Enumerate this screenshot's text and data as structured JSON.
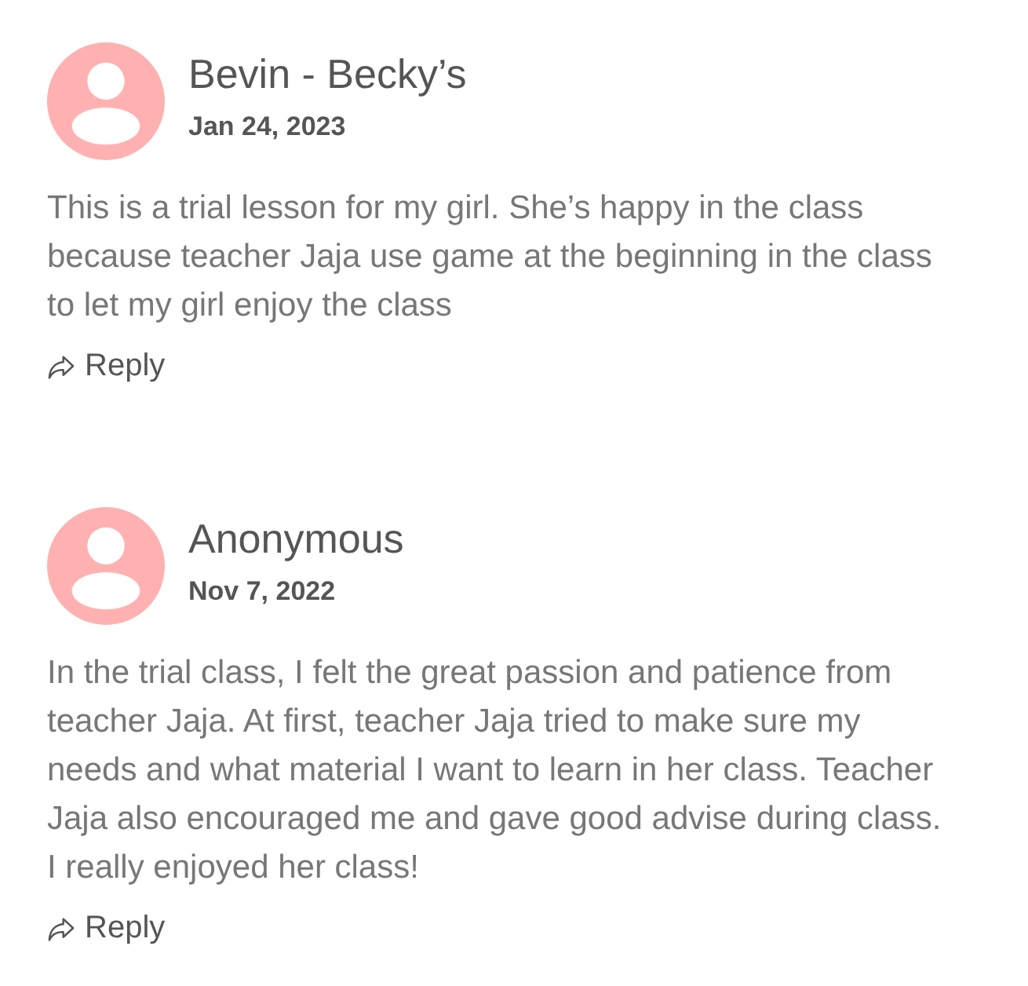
{
  "reviews": [
    {
      "author": "Bevin - Becky’s",
      "date": "Jan 24, 2023",
      "text": "This is a trial lesson for my girl. She’s happy in the class because teacher Jaja use game at the beginning in the class to let my girl enjoy the class",
      "reply_label": "Reply"
    },
    {
      "author": "Anonymous",
      "date": "Nov 7, 2022",
      "text": "In the trial class, I felt the great passion and patience from teacher Jaja. At first, teacher Jaja tried to make sure my needs and what material I want to learn in her class. Teacher Jaja also encouraged me and gave good advise during class. I really enjoyed her class!",
      "reply_label": "Reply"
    }
  ]
}
